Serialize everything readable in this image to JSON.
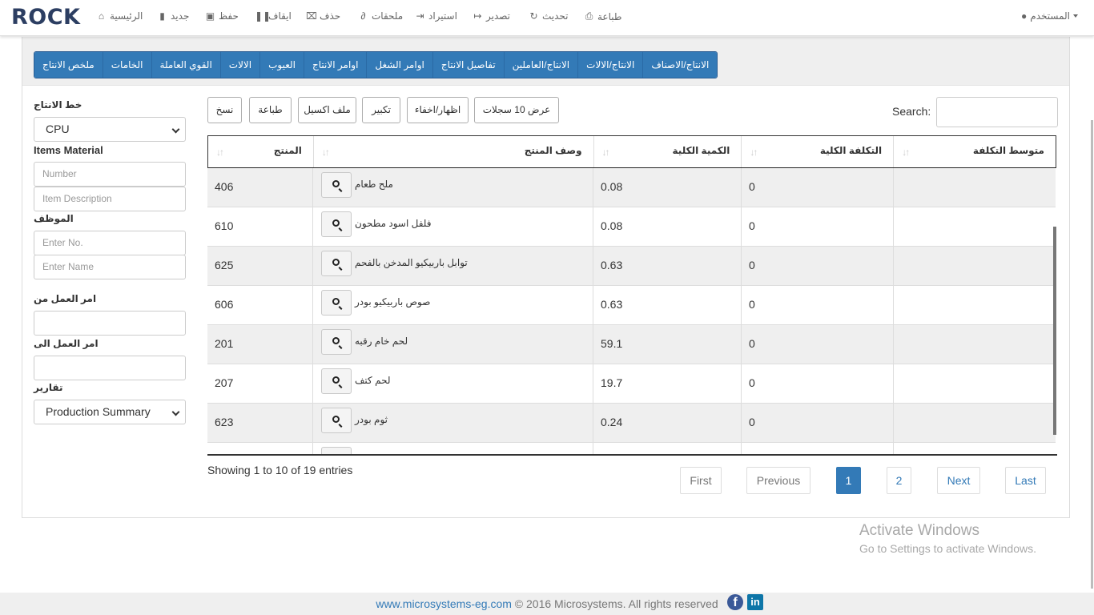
{
  "brand": "ROCK",
  "nav": {
    "home": "الرئيسية",
    "new": "جديد",
    "save": "حفظ",
    "stop": "ايقاف",
    "delete": "حذف",
    "attachments": "ملحقات",
    "import": "استيراد",
    "export": "تصدير",
    "refresh": "تحديث",
    "print": "طباعة",
    "user": "المستخدم"
  },
  "tabs": [
    "ملخص الانتاج",
    "الخامات",
    "القوي العاملة",
    "الالات",
    "العيوب",
    "اوامر الانتاج",
    "اوامر الشغل",
    "تفاصيل الانتاج",
    "الانتاج/العاملين",
    "الانتاج/الالات",
    "الانتاج/الاصناف"
  ],
  "filters": {
    "line_label": "خط الانتاج",
    "line_value": "CPU",
    "items_material_label": "Items Material",
    "number_placeholder": "Number",
    "item_desc_placeholder": "Item Description",
    "employee_label": "الموظف",
    "enter_no_placeholder": "Enter No.",
    "enter_name_placeholder": "Enter Name",
    "wo_from_label": "امر العمل من",
    "wo_to_label": "امر العمل الى",
    "reports_label": "تقارير",
    "reports_value": "Production Summary"
  },
  "toolbar": {
    "copy": "نسخ",
    "print": "طباعة",
    "excel": "ملف اكسيل",
    "zoom": "تكبير",
    "toggle": "اظهار/اخفاء",
    "show10": "عرض 10 سجلات",
    "search_label": "Search:"
  },
  "table": {
    "headers": [
      "المنتج",
      "وصف المنتج",
      "الكمية الكلية",
      "التكلفة الكلية",
      "متوسط التكلفة"
    ],
    "rows": [
      {
        "product": "406",
        "desc": "ملح طعام",
        "qty": "0.08",
        "cost": "0",
        "avg": ""
      },
      {
        "product": "610",
        "desc": "فلفل اسود مطحون",
        "qty": "0.08",
        "cost": "0",
        "avg": ""
      },
      {
        "product": "625",
        "desc": "توابل باربيكيو المدخن بالفحم",
        "qty": "0.63",
        "cost": "0",
        "avg": ""
      },
      {
        "product": "606",
        "desc": "صوص باربيكيو بودر",
        "qty": "0.63",
        "cost": "0",
        "avg": ""
      },
      {
        "product": "201",
        "desc": "لحم خام رقبه",
        "qty": "59.1",
        "cost": "0",
        "avg": ""
      },
      {
        "product": "207",
        "desc": "لحم كتف",
        "qty": "19.7",
        "cost": "0",
        "avg": ""
      },
      {
        "product": "623",
        "desc": "ثوم بودر",
        "qty": "0.24",
        "cost": "0",
        "avg": ""
      },
      {
        "product": "",
        "desc": "",
        "qty": "",
        "cost": "",
        "avg": ""
      }
    ]
  },
  "pagination": {
    "info": "Showing 1 to 10 of 19 entries",
    "first": "First",
    "previous": "Previous",
    "page1": "1",
    "page2": "2",
    "next": "Next",
    "last": "Last"
  },
  "watermark": {
    "line1": "Activate Windows",
    "line2": "Go to Settings to activate Windows."
  },
  "footer": {
    "link": "www.microsystems-eg.com",
    "text": " © 2016 Microsystems. All rights reserved"
  },
  "colors": {
    "primary": "#337ab7",
    "brand": "#2c3e62",
    "stripe": "#efefef"
  }
}
